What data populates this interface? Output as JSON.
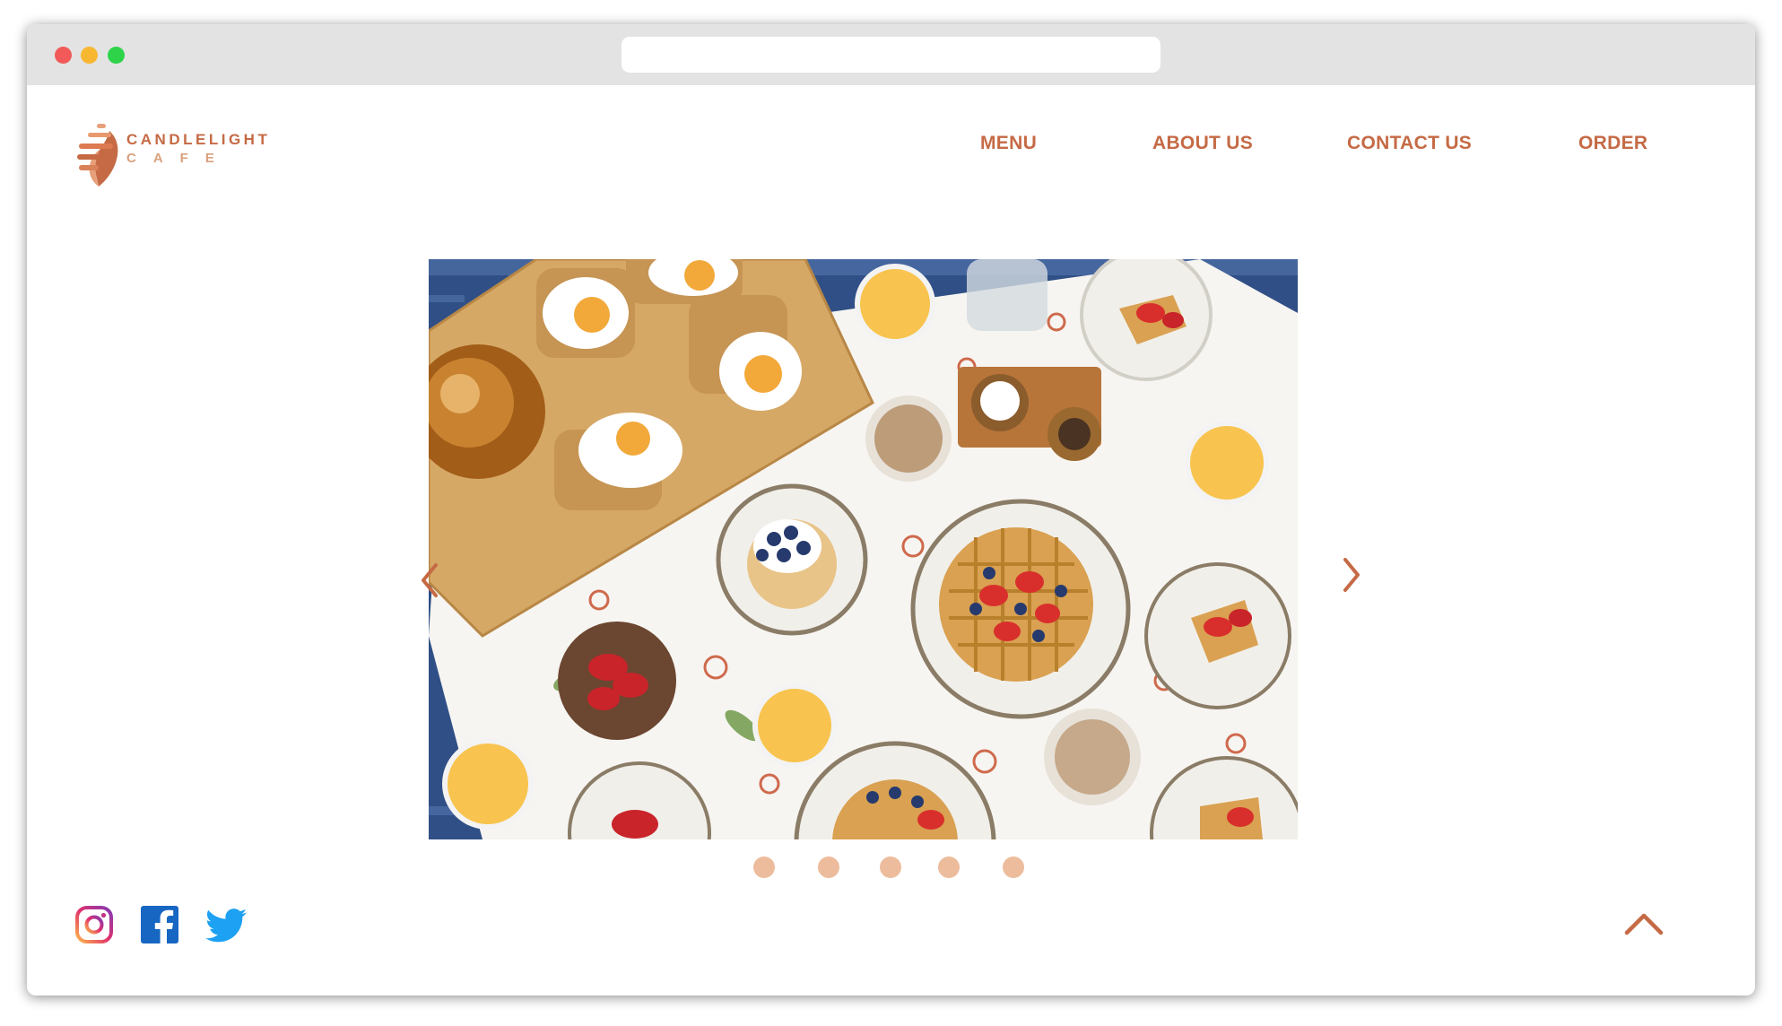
{
  "window": {
    "title_bar": "",
    "url": ""
  },
  "brand": {
    "name_line1": "CANDLELIGHT",
    "name_line2": "CAFE"
  },
  "nav": {
    "items": [
      {
        "label": "MENU"
      },
      {
        "label": "ABOUT US"
      },
      {
        "label": "CONTACT US"
      },
      {
        "label": "ORDER"
      }
    ]
  },
  "carousel": {
    "image_description_icon": "breakfast-table-photo",
    "slide_count": 5,
    "prev_icon": "chevron-left-icon",
    "next_icon": "chevron-right-icon"
  },
  "social": [
    {
      "name": "instagram-icon"
    },
    {
      "name": "facebook-icon"
    },
    {
      "name": "twitter-icon"
    }
  ],
  "colors": {
    "accent": "#c56a45",
    "accent_light": "#d9a17e",
    "dot": "#edbc9c",
    "instagram": "#d6249f",
    "facebook": "#1877f2",
    "twitter": "#1da1f2"
  }
}
